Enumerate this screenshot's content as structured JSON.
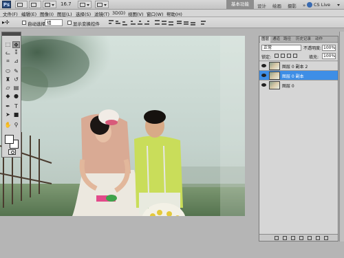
{
  "appbar": {
    "logo": "Ps",
    "zoom": "16.7",
    "workspaces": [
      "基本功能",
      "设计",
      "绘画",
      "摄影"
    ],
    "workspace_more": "»",
    "cs_live": "CS Live"
  },
  "menu": [
    "文件(F)",
    "编辑(E)",
    "图像(I)",
    "图层(L)",
    "选择(S)",
    "滤镜(T)",
    "3D(D)",
    "视图(V)",
    "窗口(W)",
    "帮助(H)"
  ],
  "options": {
    "tool_preset": "▸✢",
    "auto_select_label": "自动选择:",
    "auto_select_value": "组",
    "transform_label": "显示变换控件"
  },
  "tools": [
    "move",
    "marquee",
    "lasso",
    "magic-wand",
    "crop",
    "eyedropper",
    "healing",
    "brush",
    "clone-stamp",
    "history-brush",
    "eraser",
    "gradient",
    "blur",
    "dodge",
    "pen",
    "type",
    "path-select",
    "shape",
    "hand",
    "zoom"
  ],
  "layers_panel": {
    "tabs": [
      "图层",
      "通道",
      "路径",
      "历史记录",
      "动作"
    ],
    "blend_mode": "正常",
    "opacity_label": "不透明度:",
    "opacity_value": "100%",
    "lock_label": "锁定:",
    "fill_label": "填充:",
    "fill_value": "100%",
    "layers": [
      {
        "name": "图层 0 副本 2",
        "selected": false
      },
      {
        "name": "图层 0 副本",
        "selected": true
      },
      {
        "name": "图层 0",
        "selected": false
      }
    ]
  },
  "colors": {
    "selection": "#3e8ee6",
    "ui_gray": "#d6d6d6",
    "canvas_bg": "#b5b5b5"
  }
}
